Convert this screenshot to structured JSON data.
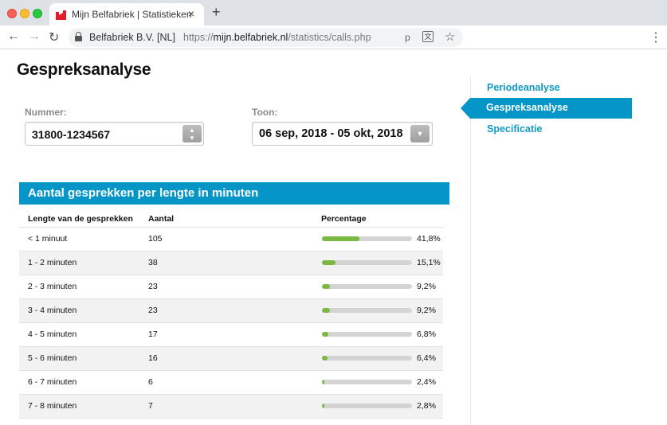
{
  "browser": {
    "tab_title": "Mijn Belfabriek | Statistieken",
    "tab_close": "×",
    "new_tab": "+",
    "site_name": "Belfabriek B.V. [NL]",
    "url_prefix": "https://",
    "url_host": "mijn.belfabriek.nl",
    "url_path": "/statistics/calls.php",
    "omni_p": "p",
    "translate_glyph": "文",
    "star_glyph": "☆",
    "menu_glyph": "⋮",
    "back_glyph": "←",
    "forward_glyph": "→",
    "reload_glyph": "↻",
    "favicon_colors": {
      "red": "#e31d2b",
      "white": "#ffffff"
    }
  },
  "page": {
    "title": "Gespreksanalyse",
    "nummer_label": "Nummer:",
    "nummer_value": "31800-1234567",
    "nummer_button_glyph": "▲\n▼",
    "toon_label": "Toon:",
    "toon_value": "06 sep, 2018 - 05 okt, 2018",
    "toon_button_glyph": "▼"
  },
  "panel": {
    "title": "Aantal gesprekken per lengte in minuten",
    "headers": {
      "length": "Lengte van de gesprekken",
      "count": "Aantal",
      "percentage": "Percentage"
    },
    "rows": [
      {
        "length": "< 1 minuut",
        "count": "105",
        "percentage": "41,8%",
        "fraction": 0.418
      },
      {
        "length": "1 - 2 minuten",
        "count": "38",
        "percentage": "15,1%",
        "fraction": 0.151
      },
      {
        "length": "2 - 3 minuten",
        "count": "23",
        "percentage": "9,2%",
        "fraction": 0.092
      },
      {
        "length": "3 - 4 minuten",
        "count": "23",
        "percentage": "9,2%",
        "fraction": 0.092
      },
      {
        "length": "4 - 5 minuten",
        "count": "17",
        "percentage": "6,8%",
        "fraction": 0.068
      },
      {
        "length": "5 - 6 minuten",
        "count": "16",
        "percentage": "6,4%",
        "fraction": 0.064
      },
      {
        "length": "6 - 7 minuten",
        "count": "6",
        "percentage": "2,4%",
        "fraction": 0.024
      },
      {
        "length": "7 - 8 minuten",
        "count": "7",
        "percentage": "2,8%",
        "fraction": 0.028
      }
    ]
  },
  "sidebar": {
    "items": [
      {
        "label": "Periodeanalyse",
        "active": false
      },
      {
        "label": "Gespreksanalyse",
        "active": true
      },
      {
        "label": "Specificatie",
        "active": false
      }
    ]
  },
  "colors": {
    "accent": "#0596c7",
    "bar": "#7ab842",
    "bar_track": "#d4d4d4",
    "link": "#1499c4"
  }
}
